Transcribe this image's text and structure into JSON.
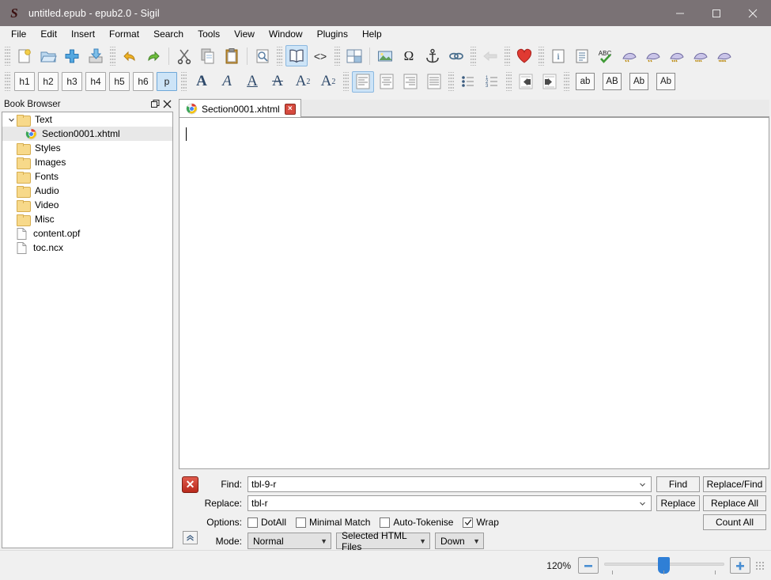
{
  "window": {
    "title": "untitled.epub - epub2.0 - Sigil",
    "logo_letter": "S",
    "controls": {
      "minimize": "minimize-icon",
      "maximize": "maximize-icon",
      "close": "close-icon"
    }
  },
  "menubar": {
    "items": [
      {
        "label": "File"
      },
      {
        "label": "Edit"
      },
      {
        "label": "Insert"
      },
      {
        "label": "Format"
      },
      {
        "label": "Search"
      },
      {
        "label": "Tools"
      },
      {
        "label": "View"
      },
      {
        "label": "Window"
      },
      {
        "label": "Plugins"
      },
      {
        "label": "Help"
      }
    ]
  },
  "toolbar_main": {
    "groups": [
      {
        "items": [
          {
            "name": "new-file-icon",
            "title": "New"
          },
          {
            "name": "open-folder-icon",
            "title": "Open"
          },
          {
            "name": "add-file-icon",
            "title": "Add"
          },
          {
            "name": "save-icon",
            "title": "Save"
          }
        ]
      },
      {
        "items": [
          {
            "name": "undo-icon",
            "title": "Undo"
          },
          {
            "name": "redo-icon",
            "title": "Redo"
          }
        ]
      },
      {
        "items": [
          {
            "name": "cut-scissors-icon",
            "title": "Cut"
          },
          {
            "name": "copy-icon",
            "title": "Copy"
          },
          {
            "name": "paste-clipboard-icon",
            "title": "Paste"
          }
        ]
      },
      {
        "items": [
          {
            "name": "print-preview-icon",
            "title": "Print Preview"
          }
        ]
      },
      {
        "items": [
          {
            "name": "book-view-icon",
            "title": "Book View",
            "checked": true
          },
          {
            "name": "code-view-icon",
            "title": "Code View",
            "label": "<>"
          }
        ]
      },
      {
        "items": [
          {
            "name": "split-view-icon",
            "title": "Split View"
          }
        ]
      },
      {
        "items": [
          {
            "name": "insert-image-icon",
            "title": "Insert Image"
          },
          {
            "name": "insert-special-character-icon",
            "title": "Insert Special Character",
            "label": "Ω"
          },
          {
            "name": "insert-anchor-icon",
            "title": "Insert Anchor"
          },
          {
            "name": "insert-link-icon",
            "title": "Insert Link"
          }
        ]
      },
      {
        "items": [
          {
            "name": "back-arrow-icon",
            "title": "Back",
            "disabled": true
          }
        ]
      },
      {
        "items": [
          {
            "name": "heart-icon",
            "title": "Donate"
          }
        ]
      },
      {
        "items": [
          {
            "name": "metadata-editor-icon",
            "title": "Metadata Editor"
          },
          {
            "name": "generate-toc-icon",
            "title": "Generate Table Of Contents"
          },
          {
            "name": "spellcheck-icon",
            "title": "Spellcheck",
            "label": "ABC"
          },
          {
            "name": "well-formed-check-icon",
            "title": "Well-Formed Check"
          },
          {
            "name": "mend-icon",
            "title": "Mend"
          },
          {
            "name": "mend-and-prettify-icon",
            "title": "Mend And Prettify"
          },
          {
            "name": "validate-stylesheets-icon",
            "title": "Validate Stylesheets"
          },
          {
            "name": "validate-epub-icon",
            "title": "Validate EPUB"
          }
        ]
      }
    ]
  },
  "toolbar_format": {
    "headings": [
      {
        "label": "h1",
        "checked": false
      },
      {
        "label": "h2",
        "checked": false
      },
      {
        "label": "h3",
        "checked": false
      },
      {
        "label": "h4",
        "checked": false
      },
      {
        "label": "h5",
        "checked": false
      },
      {
        "label": "h6",
        "checked": false
      },
      {
        "label": "p",
        "checked": true
      }
    ],
    "styles": [
      {
        "name": "bold-icon",
        "label": "A",
        "title": "Bold"
      },
      {
        "name": "italic-icon",
        "label": "A",
        "title": "Italic"
      },
      {
        "name": "underline-icon",
        "label": "A",
        "title": "Underline"
      },
      {
        "name": "strikethrough-icon",
        "label": "A",
        "title": "Strikethrough"
      },
      {
        "name": "subscript-icon",
        "label": "A",
        "title": "Subscript",
        "sup": "2"
      },
      {
        "name": "superscript-icon",
        "label": "A",
        "title": "Superscript",
        "sup": "2"
      }
    ],
    "align": [
      {
        "name": "align-left-icon",
        "title": "Align Left",
        "checked": true
      },
      {
        "name": "align-center-icon",
        "title": "Align Center",
        "checked": false
      },
      {
        "name": "align-right-icon",
        "title": "Align Right",
        "checked": false
      },
      {
        "name": "align-justify-icon",
        "title": "Justify",
        "checked": false
      }
    ],
    "lists": [
      {
        "name": "bullet-list-icon",
        "title": "Bulleted List"
      },
      {
        "name": "numbered-list-icon",
        "title": "Numbered List"
      }
    ],
    "indent": [
      {
        "name": "decrease-indent-icon",
        "title": "Decrease Indent"
      },
      {
        "name": "increase-indent-icon",
        "title": "Increase Indent"
      }
    ],
    "case": [
      {
        "label": "ab",
        "name": "lowercase-button",
        "title": "Lowercase"
      },
      {
        "label": "AB",
        "name": "uppercase-button",
        "title": "Uppercase"
      },
      {
        "label": "Ab",
        "name": "titlecase-button",
        "title": "Titlecase"
      },
      {
        "label": "Ab",
        "name": "capitalize-button",
        "title": "Capitalize"
      }
    ]
  },
  "book_browser": {
    "title": "Book Browser",
    "float_icon": "float-icon",
    "close_icon": "close-icon",
    "items": [
      {
        "label": "Text",
        "type": "folder",
        "expanded": true,
        "depth": 0,
        "selected": false
      },
      {
        "label": "Section0001.xhtml",
        "type": "xhtml",
        "depth": 1,
        "selected": true
      },
      {
        "label": "Styles",
        "type": "folder",
        "depth": 0,
        "selected": false
      },
      {
        "label": "Images",
        "type": "folder",
        "depth": 0,
        "selected": false
      },
      {
        "label": "Fonts",
        "type": "folder",
        "depth": 0,
        "selected": false
      },
      {
        "label": "Audio",
        "type": "folder",
        "depth": 0,
        "selected": false
      },
      {
        "label": "Video",
        "type": "folder",
        "depth": 0,
        "selected": false
      },
      {
        "label": "Misc",
        "type": "folder",
        "depth": 0,
        "selected": false
      },
      {
        "label": "content.opf",
        "type": "file",
        "depth": 0,
        "selected": false
      },
      {
        "label": "toc.ncx",
        "type": "file",
        "depth": 0,
        "selected": false
      }
    ]
  },
  "editor": {
    "tab": {
      "label": "Section0001.xhtml",
      "icon": "xhtml-icon",
      "close_label": "×"
    },
    "content": ""
  },
  "find_replace": {
    "close_label": "✕",
    "collapse_icon": "chevron-up-icon",
    "find_label": "Find:",
    "find_value": "tbl-9-r",
    "replace_label": "Replace:",
    "replace_value": "tbl-r",
    "options_label": "Options:",
    "options": [
      {
        "label": "DotAll",
        "checked": false
      },
      {
        "label": "Minimal Match",
        "checked": false
      },
      {
        "label": "Auto-Tokenise",
        "checked": false
      },
      {
        "label": "Wrap",
        "checked": true
      }
    ],
    "mode_label": "Mode:",
    "mode_value": "Normal",
    "scope_value": "Selected HTML Files",
    "direction_value": "Down",
    "buttons": {
      "find": "Find",
      "replace_find": "Replace/Find",
      "replace": "Replace",
      "replace_all": "Replace All",
      "count_all": "Count All"
    }
  },
  "statusbar": {
    "zoom_label": "120%",
    "zoom_out_label": "−",
    "zoom_in_label": "+"
  },
  "colors": {
    "titlebar": "#7a7275",
    "chrome": "#f0f0f0",
    "accent_blue": "#2f7fd6",
    "selected_tint": "#cde4f7",
    "close_red": "#c0392b"
  }
}
